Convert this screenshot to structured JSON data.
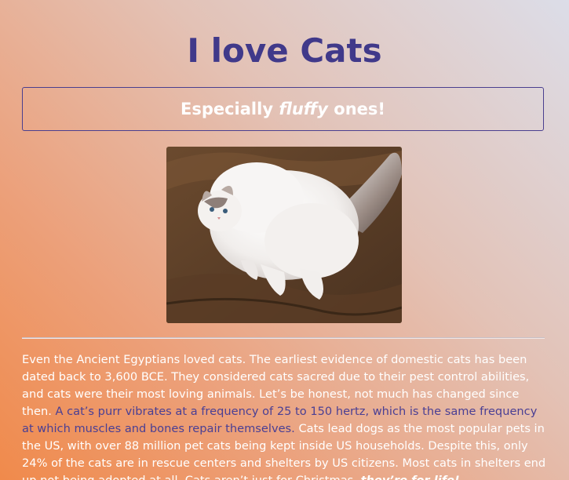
{
  "page": {
    "title": "I love Cats",
    "subtitle_pre": "Especially ",
    "subtitle_em": "fluffy",
    "subtitle_post": " ones!",
    "image_icon": "fluffy-cat-photo"
  },
  "article": {
    "part1": "Even the Ancient Egyptians loved cats. The earliest evidence of domestic cats has been dated back to 3,600 BCE. They considered cats sacred due to their pest control abilities, and cats were their most loving animals. Let’s be honest, not much has changed since then. ",
    "part2": "A cat’s purr vibrates at a frequency of 25 to 150 hertz, which is the same frequency at which muscles and bones repair themselves.",
    "part3": " Cats lead dogs as the most popular pets in the US, with over 88 million pet cats being kept inside US households. Despite this, only 24% of the cats are in rescue centers and shelters by US citizens. Most cats in shelters end up not being adopted at all. Cats aren’t just for Christmas, ",
    "part4": "they’re for life!"
  },
  "colors": {
    "title": "#40398a",
    "accent_text": "#4a3f94",
    "body_text": "#ffffff"
  }
}
